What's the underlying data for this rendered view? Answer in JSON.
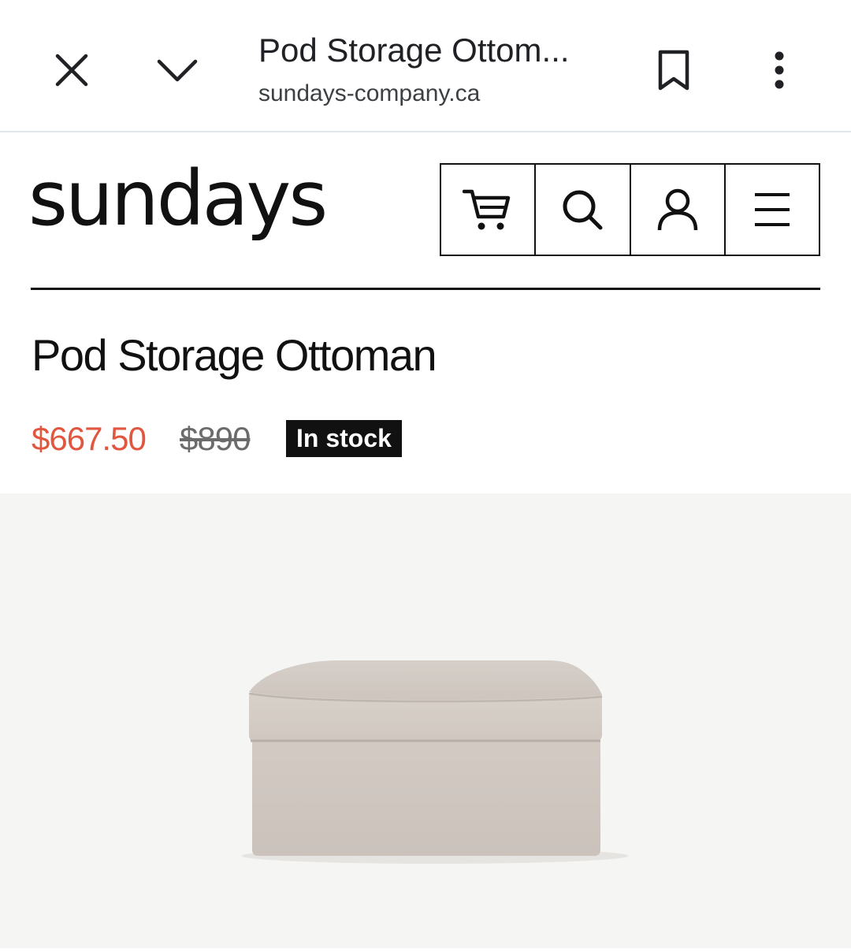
{
  "browser": {
    "tab_title": "Pod Storage Ottom...",
    "url": "sundays-company.ca"
  },
  "site": {
    "logo_text": "sundays"
  },
  "nav": {
    "icons": [
      "cart-icon",
      "search-icon",
      "account-icon",
      "menu-icon"
    ]
  },
  "product": {
    "title": "Pod Storage Ottoman",
    "price_sale": "$667.50",
    "price_original": "$890",
    "stock_status": "In stock"
  },
  "colors": {
    "sale_price": "#e0563f",
    "badge_bg": "#111111",
    "media_bg": "#f5f5f3",
    "ottoman_fabric": "#d8d0c9"
  }
}
